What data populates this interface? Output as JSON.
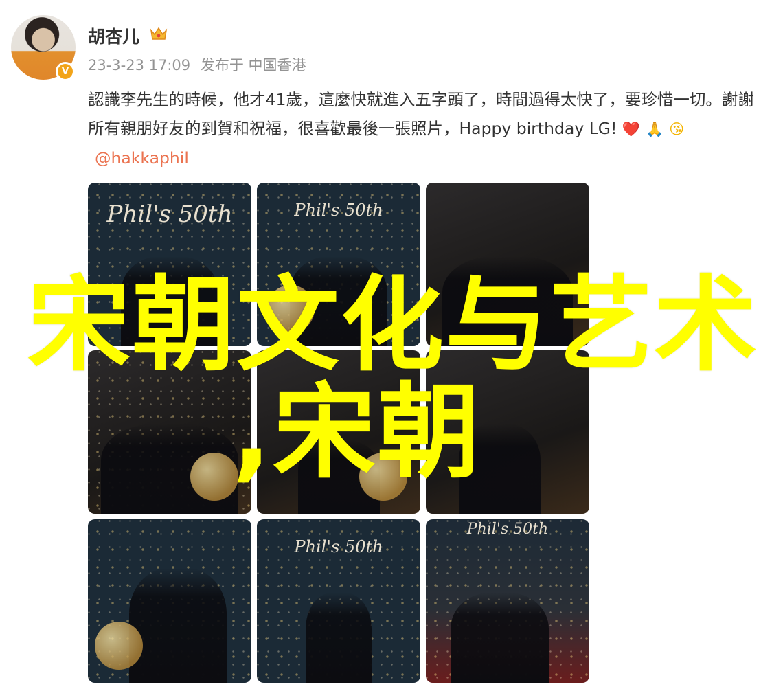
{
  "user": {
    "name": "胡杏儿",
    "badge_icon": "crown-icon",
    "verified_icon": "verified-v-icon",
    "time": "23-3-23 17:09",
    "source": "发布于 中国香港"
  },
  "post": {
    "text": "認識李先生的時候，他才41歲，這麼快就進入五字頭了，時間過得太快了，要珍惜一切。謝謝所有親朋好友的到賀和祝福，很喜歡最後一張照片，Happy birthday LG!",
    "emojis": [
      "❤️",
      "🙏",
      "😘"
    ],
    "mention": "@hakkaphil"
  },
  "photos": [
    {
      "sign": "Phil's 50th"
    },
    {
      "sign": "Phil's 50th"
    },
    {
      "sign": ""
    },
    {
      "sign": ""
    },
    {
      "sign": ""
    },
    {
      "sign": ""
    },
    {
      "sign": ""
    },
    {
      "sign": "Phil's 50th"
    },
    {
      "sign": "Phil's 50th"
    }
  ],
  "overlay": {
    "line1": "宋朝文化与艺术",
    "line2": ",宋朝"
  },
  "colors": {
    "mention": "#eb7350",
    "overlay": "#ffff00",
    "meta": "#939393"
  }
}
